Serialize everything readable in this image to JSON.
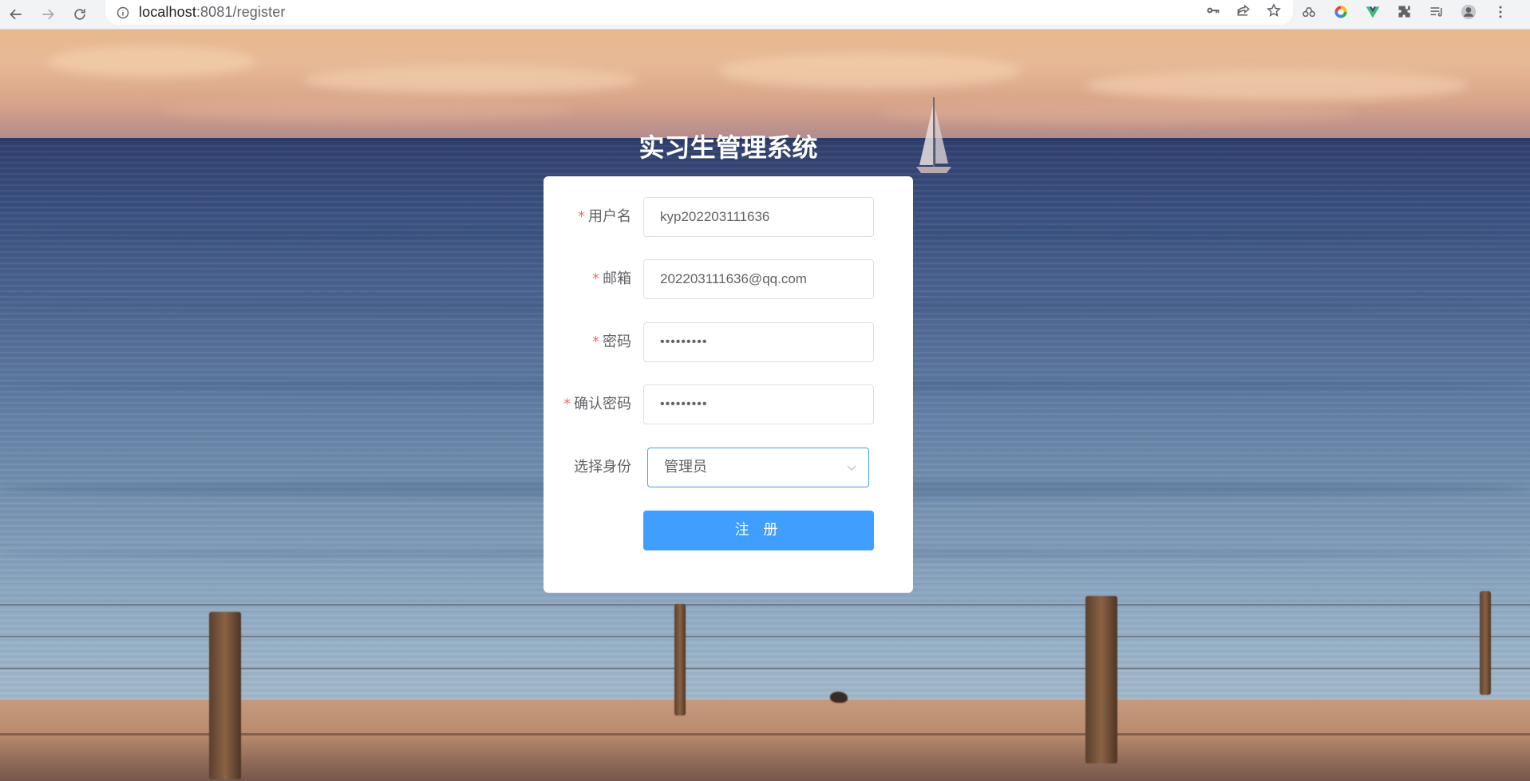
{
  "browser": {
    "url_host": "localhost",
    "url_path": ":8081/register",
    "icons": [
      "back-arrow-icon",
      "forward-arrow-icon",
      "reload-icon",
      "info-icon",
      "key-icon",
      "share-icon",
      "star-icon",
      "extension-icon",
      "profile-icon",
      "menu-icon"
    ]
  },
  "page": {
    "title": "实习生管理系统"
  },
  "form": {
    "username": {
      "label": "用户名",
      "value": "kyp202203111636",
      "required_mark": "*"
    },
    "email": {
      "label": "邮箱",
      "value": "202203111636@qq.com",
      "required_mark": "*"
    },
    "password": {
      "label": "密码",
      "value": "•••••••••",
      "required_mark": "*"
    },
    "confirm_password": {
      "label": "确认密码",
      "value": "•••••••••",
      "required_mark": "*"
    },
    "role": {
      "label": "选择身份",
      "selected": "管理员"
    },
    "submit_label": "注 册"
  },
  "colors": {
    "primary": "#409eff",
    "required": "#f56c6c",
    "label": "#606266",
    "border": "#dcdfe6"
  }
}
